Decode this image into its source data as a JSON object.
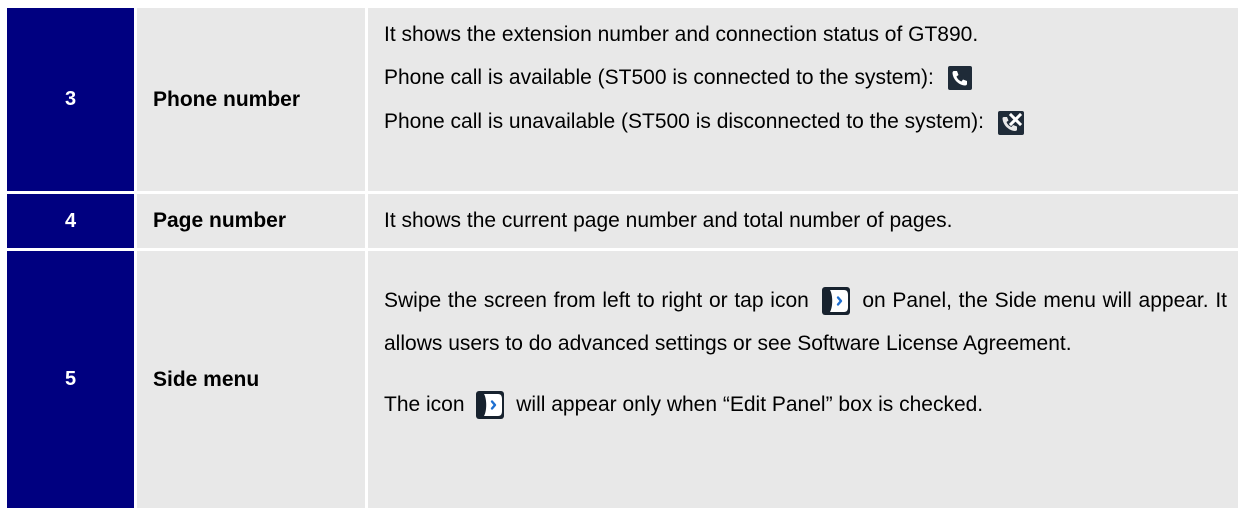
{
  "rows": [
    {
      "number": "3",
      "name": "Phone number",
      "lines": [
        "It shows the extension number and connection status of GT890.",
        "Phone call is available (ST500 is connected to the system):",
        "Phone call is unavailable (ST500 is disconnected to the system):"
      ],
      "icons": [
        "phone-available-icon",
        "phone-unavailable-icon"
      ]
    },
    {
      "number": "4",
      "name": "Page number",
      "description": "It shows the current page number and total number of pages."
    },
    {
      "number": "5",
      "name": "Side menu",
      "para_before_icon": "Swipe the screen from left to right or tap icon",
      "para_after_icon": "on Panel, the Side menu will appear. It allows users to do advanced settings or see Software License Agreement.",
      "last_before_icon": "The icon",
      "last_after_icon": "will appear only when “Edit Panel” box is checked.",
      "icons": [
        "side-menu-arrow-icon"
      ]
    }
  ],
  "colors": {
    "number_cell_bg": "#000080",
    "cell_bg": "#e8e8e8"
  }
}
